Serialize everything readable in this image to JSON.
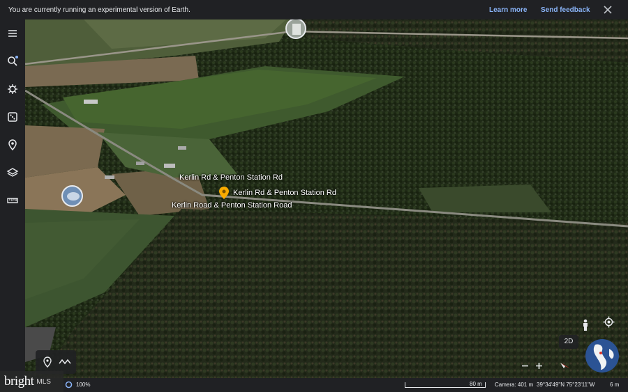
{
  "banner": {
    "message": "You are currently running an experimental version of Earth.",
    "learn_more": "Learn more",
    "send_feedback": "Send feedback"
  },
  "sidebar": {
    "items": [
      {
        "icon": "menu-icon"
      },
      {
        "icon": "search-icon"
      },
      {
        "icon": "voyager-icon"
      },
      {
        "icon": "dice-icon"
      },
      {
        "icon": "projects-icon"
      },
      {
        "icon": "map-style-icon"
      },
      {
        "icon": "measure-icon"
      }
    ]
  },
  "map": {
    "labels": [
      "Kerlin Rd & Penton Station Rd",
      "Kerlin Rd & Penton Station Rd",
      "Kerlin Road & Penton Station Road"
    ]
  },
  "controls": {
    "mode_2d": "2D"
  },
  "status": {
    "zoom_percent": "100%",
    "scale": "80 m",
    "camera": "Camera: 401 m",
    "coordinates": "39°34'49\"N 75°23'11\"W",
    "elevation": "6 m"
  },
  "branding": {
    "logo_main": "bright",
    "logo_sub": "MLS"
  },
  "colors": {
    "link": "#8ab4f8",
    "ui_dark": "#202124",
    "pin": "#f9ab00"
  }
}
